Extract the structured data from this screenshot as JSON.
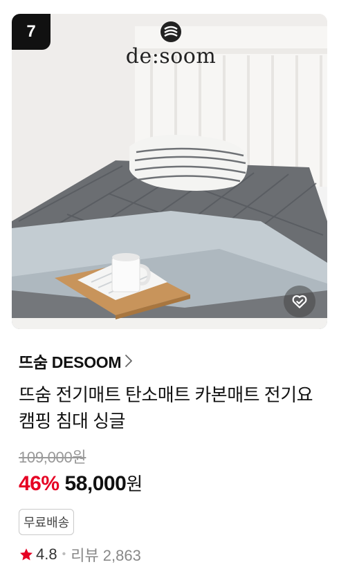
{
  "rank": "7",
  "thumbnail": {
    "logo_text": "de:soom"
  },
  "store": {
    "name": "뜨숨 DESOOM"
  },
  "product": {
    "title": "뜨숨 전기매트 탄소매트 카본매트 전기요 캠핑 침대 싱글",
    "original_price": "109,000원",
    "discount": "46%",
    "sale_price": "58,000",
    "currency": "원"
  },
  "badges": {
    "shipping": "무료배송"
  },
  "rating": {
    "score": "4.8",
    "reviews": "리뷰 2,863"
  },
  "colors": {
    "discount": "#e60023",
    "star": "#e60023"
  },
  "icons": {
    "wishlist": "heart-check-icon",
    "store_link": "chevron-right-icon",
    "rating": "star-icon"
  }
}
